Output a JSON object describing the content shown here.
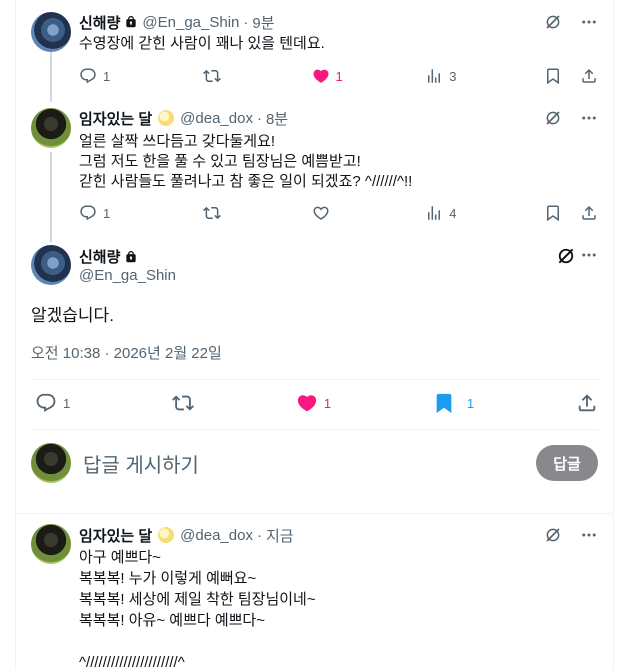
{
  "posts": [
    {
      "name": "신해량",
      "handle": "@En_ga_Shin",
      "time": "9분",
      "text": "수영장에 갇힌 사람이 꽤나 있을 텐데요.",
      "reply_count": "1",
      "like_count": "1",
      "view_count": "3"
    },
    {
      "name": "임자있는 달",
      "handle": "@dea_dox",
      "time": "8분",
      "text": "얼른 살짝 쓰다듬고 갖다둘게요!\n그럼 저도 한을 풀 수 있고 팀장님은 예쁨받고!\n갇힌 사람들도 풀려나고 참 좋은 일이 되겠죠? ^//////^!!",
      "reply_count": "1",
      "view_count": "4"
    }
  ],
  "focus": {
    "name": "신해량",
    "handle": "@En_ga_Shin",
    "text": "알겠습니다.",
    "meta": "오전 10:38 · 2026년 2월 22일",
    "reply_count": "1",
    "like_count": "1",
    "bookmark_count": "1"
  },
  "composer": {
    "placeholder": "답글 게시하기",
    "button_label": "답글"
  },
  "reply": {
    "name": "임자있는 달",
    "handle": "@dea_dox",
    "time": "지금",
    "text": "아구 예쁘다~\n복복복! 누가 이렇게 예뻐요~\n복복복! 세상에 제일 착한 팀장님이네~\n복복복! 아유~ 예쁘다 예쁘다~\n\n^//////////////////////^"
  },
  "colors": {
    "like_active": "#f91880",
    "bookmark_active": "#1d9bf0",
    "secondary_text": "#536471"
  }
}
